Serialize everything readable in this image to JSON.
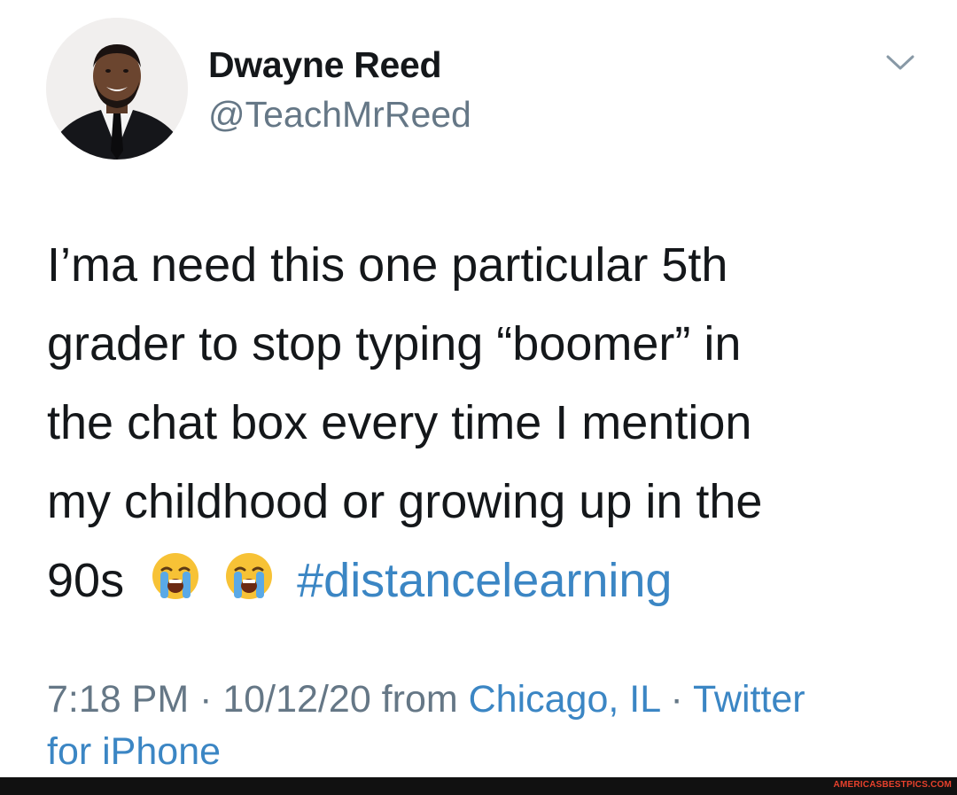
{
  "author": {
    "display_name": "Dwayne Reed",
    "handle": "@TeachMrReed"
  },
  "tweet": {
    "text_lines": [
      "I’ma need this one particular 5th",
      "grader to stop typing “boomer” in",
      "the chat box every time I mention",
      "my childhood or growing up in the"
    ],
    "last_line_prefix": "90s",
    "emojis": [
      "loudly-crying-face",
      "loudly-crying-face"
    ],
    "hashtag": "#distancelearning"
  },
  "meta": {
    "time_date": "7:18 PM · 10/12/20 from ",
    "location": "Chicago, IL",
    "separator": " · ",
    "source_part1": "Twitter",
    "source_part2": "for iPhone"
  },
  "colors": {
    "link": "#3b86c4",
    "secondary": "#657786",
    "primary": "#14171a"
  },
  "watermark": "AMERICASBESTPICS.COM"
}
